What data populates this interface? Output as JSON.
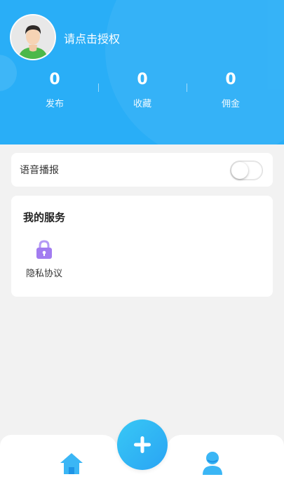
{
  "header": {
    "auth_text": "请点击授权",
    "stats": [
      {
        "value": "0",
        "label": "发布"
      },
      {
        "value": "0",
        "label": "收藏"
      },
      {
        "value": "0",
        "label": "佣金"
      }
    ]
  },
  "voice": {
    "label": "语音播报",
    "enabled": false
  },
  "services": {
    "title": "我的服务",
    "items": [
      {
        "label": "隐私协议",
        "icon": "lock-icon"
      }
    ]
  },
  "tabbar": {
    "icons": [
      "home-icon",
      "plus-icon",
      "user-icon"
    ]
  },
  "colors": {
    "brand": "#29aef7",
    "accent_purple": "#a27cf0",
    "background": "#f2f2f2"
  }
}
